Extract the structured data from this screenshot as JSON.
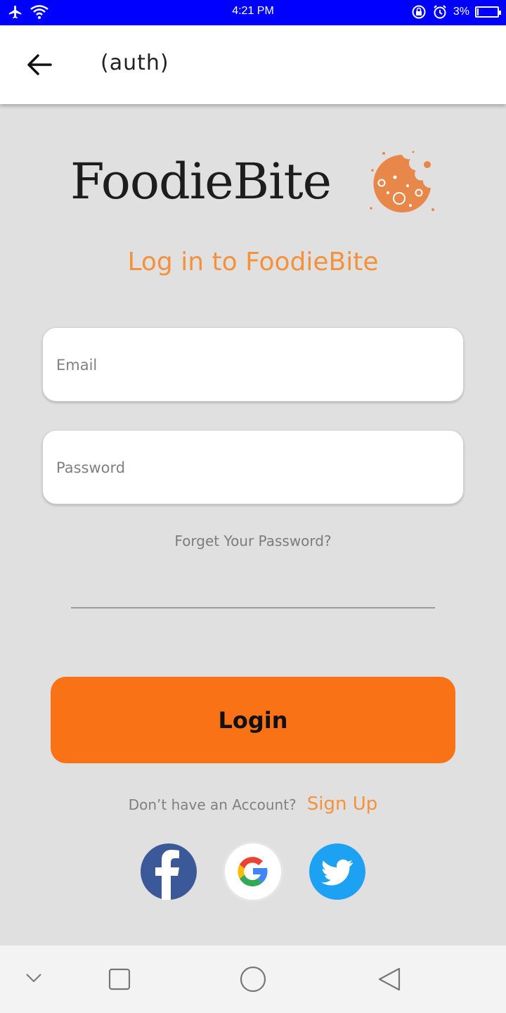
{
  "status_bar": {
    "time": "4:21 PM",
    "battery_text": "3%",
    "battery_level": 0.03
  },
  "appbar": {
    "title": "(auth)"
  },
  "logo": {
    "text": "FoodieBite",
    "accent_color": "#e8874a"
  },
  "subtitle": "Log in to FoodieBite",
  "form": {
    "email_placeholder": "Email",
    "password_placeholder": "Password",
    "forgot_label": "Forget Your Password?",
    "login_label": "Login"
  },
  "signup": {
    "question": "Don’t have an Account?",
    "link": "Sign Up"
  },
  "social": [
    "facebook-icon",
    "google-icon",
    "twitter-icon"
  ],
  "colors": {
    "status_bar": "#0000ff",
    "accent": "#f97316",
    "link": "#f5913b",
    "background": "#e0e0e0"
  }
}
